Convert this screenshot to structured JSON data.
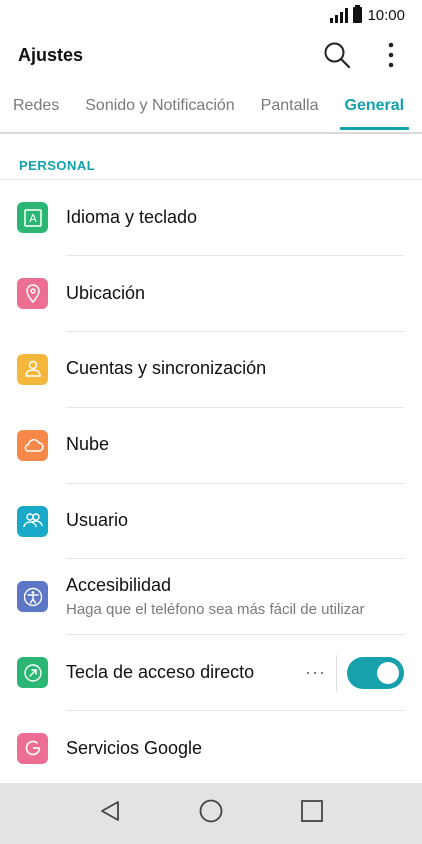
{
  "status_bar": {
    "time": "10:00",
    "icons": [
      "signal-icon",
      "battery-icon"
    ]
  },
  "app_bar": {
    "title": "Ajustes",
    "icons": [
      "search-icon",
      "more-vert-icon"
    ]
  },
  "tabs": [
    {
      "label": "Redes",
      "active": false
    },
    {
      "label": "Sonido y Notificación",
      "active": false
    },
    {
      "label": "Pantalla",
      "active": false
    },
    {
      "label": "General",
      "active": true
    }
  ],
  "section": {
    "label": "PERSONAL"
  },
  "items": [
    {
      "title": "Idioma y teclado",
      "icon": "language-keyboard-icon",
      "color": "#2bb673"
    },
    {
      "title": "Ubicación",
      "icon": "location-pin-icon",
      "color": "#ec6f93"
    },
    {
      "title": "Cuentas y sincronización",
      "icon": "accounts-sync-icon",
      "color": "#f4b73c"
    },
    {
      "title": "Nube",
      "icon": "cloud-icon",
      "color": "#f6894a"
    },
    {
      "title": "Usuario",
      "icon": "users-icon",
      "color": "#1aa9c8"
    },
    {
      "title": "Accesibilidad",
      "subtitle": "Haga que el teléfono sea más fácil de utilizar",
      "icon": "accessibility-icon",
      "color": "#5c77c5"
    },
    {
      "title": "Tecla de acceso directo",
      "icon": "shortcut-key-icon",
      "color": "#2bb673",
      "toggle_on": true,
      "more": "···"
    },
    {
      "title": "Servicios Google",
      "icon": "google-icon",
      "color": "#ec6f93"
    }
  ],
  "nav_bar": {
    "icons": [
      "back-icon",
      "home-icon",
      "recents-icon"
    ]
  }
}
